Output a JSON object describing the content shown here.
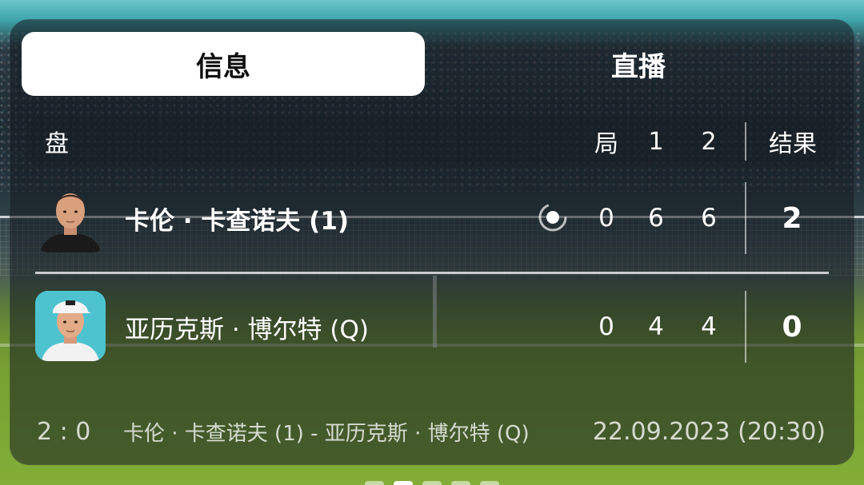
{
  "tabs": {
    "info_label": "信息",
    "live_label": "直播"
  },
  "header": {
    "set_label": "盘",
    "game_label": "局",
    "set1_label": "1",
    "set2_label": "2",
    "result_label": "结果"
  },
  "players": [
    {
      "name": "卡伦 · 卡查诺夫 (1)",
      "game": "0",
      "set1": "6",
      "set2": "6",
      "result": "2",
      "serving": true,
      "bold": true
    },
    {
      "name": "亚历克斯 · 博尔特 (Q)",
      "game": "0",
      "set1": "4",
      "set2": "4",
      "result": "0",
      "serving": false,
      "bold": false
    }
  ],
  "footer": {
    "score": "2 : 0",
    "match": "卡伦 · 卡查诺夫 (1) - 亚历克斯 · 博尔特 (Q)",
    "datetime": "22.09.2023 (20:30)"
  },
  "pager": {
    "count": 5,
    "active_index": 1
  },
  "colors": {
    "card_overlay": "#141a20",
    "tab_active_bg": "#ffffff",
    "text": "#ffffff"
  }
}
